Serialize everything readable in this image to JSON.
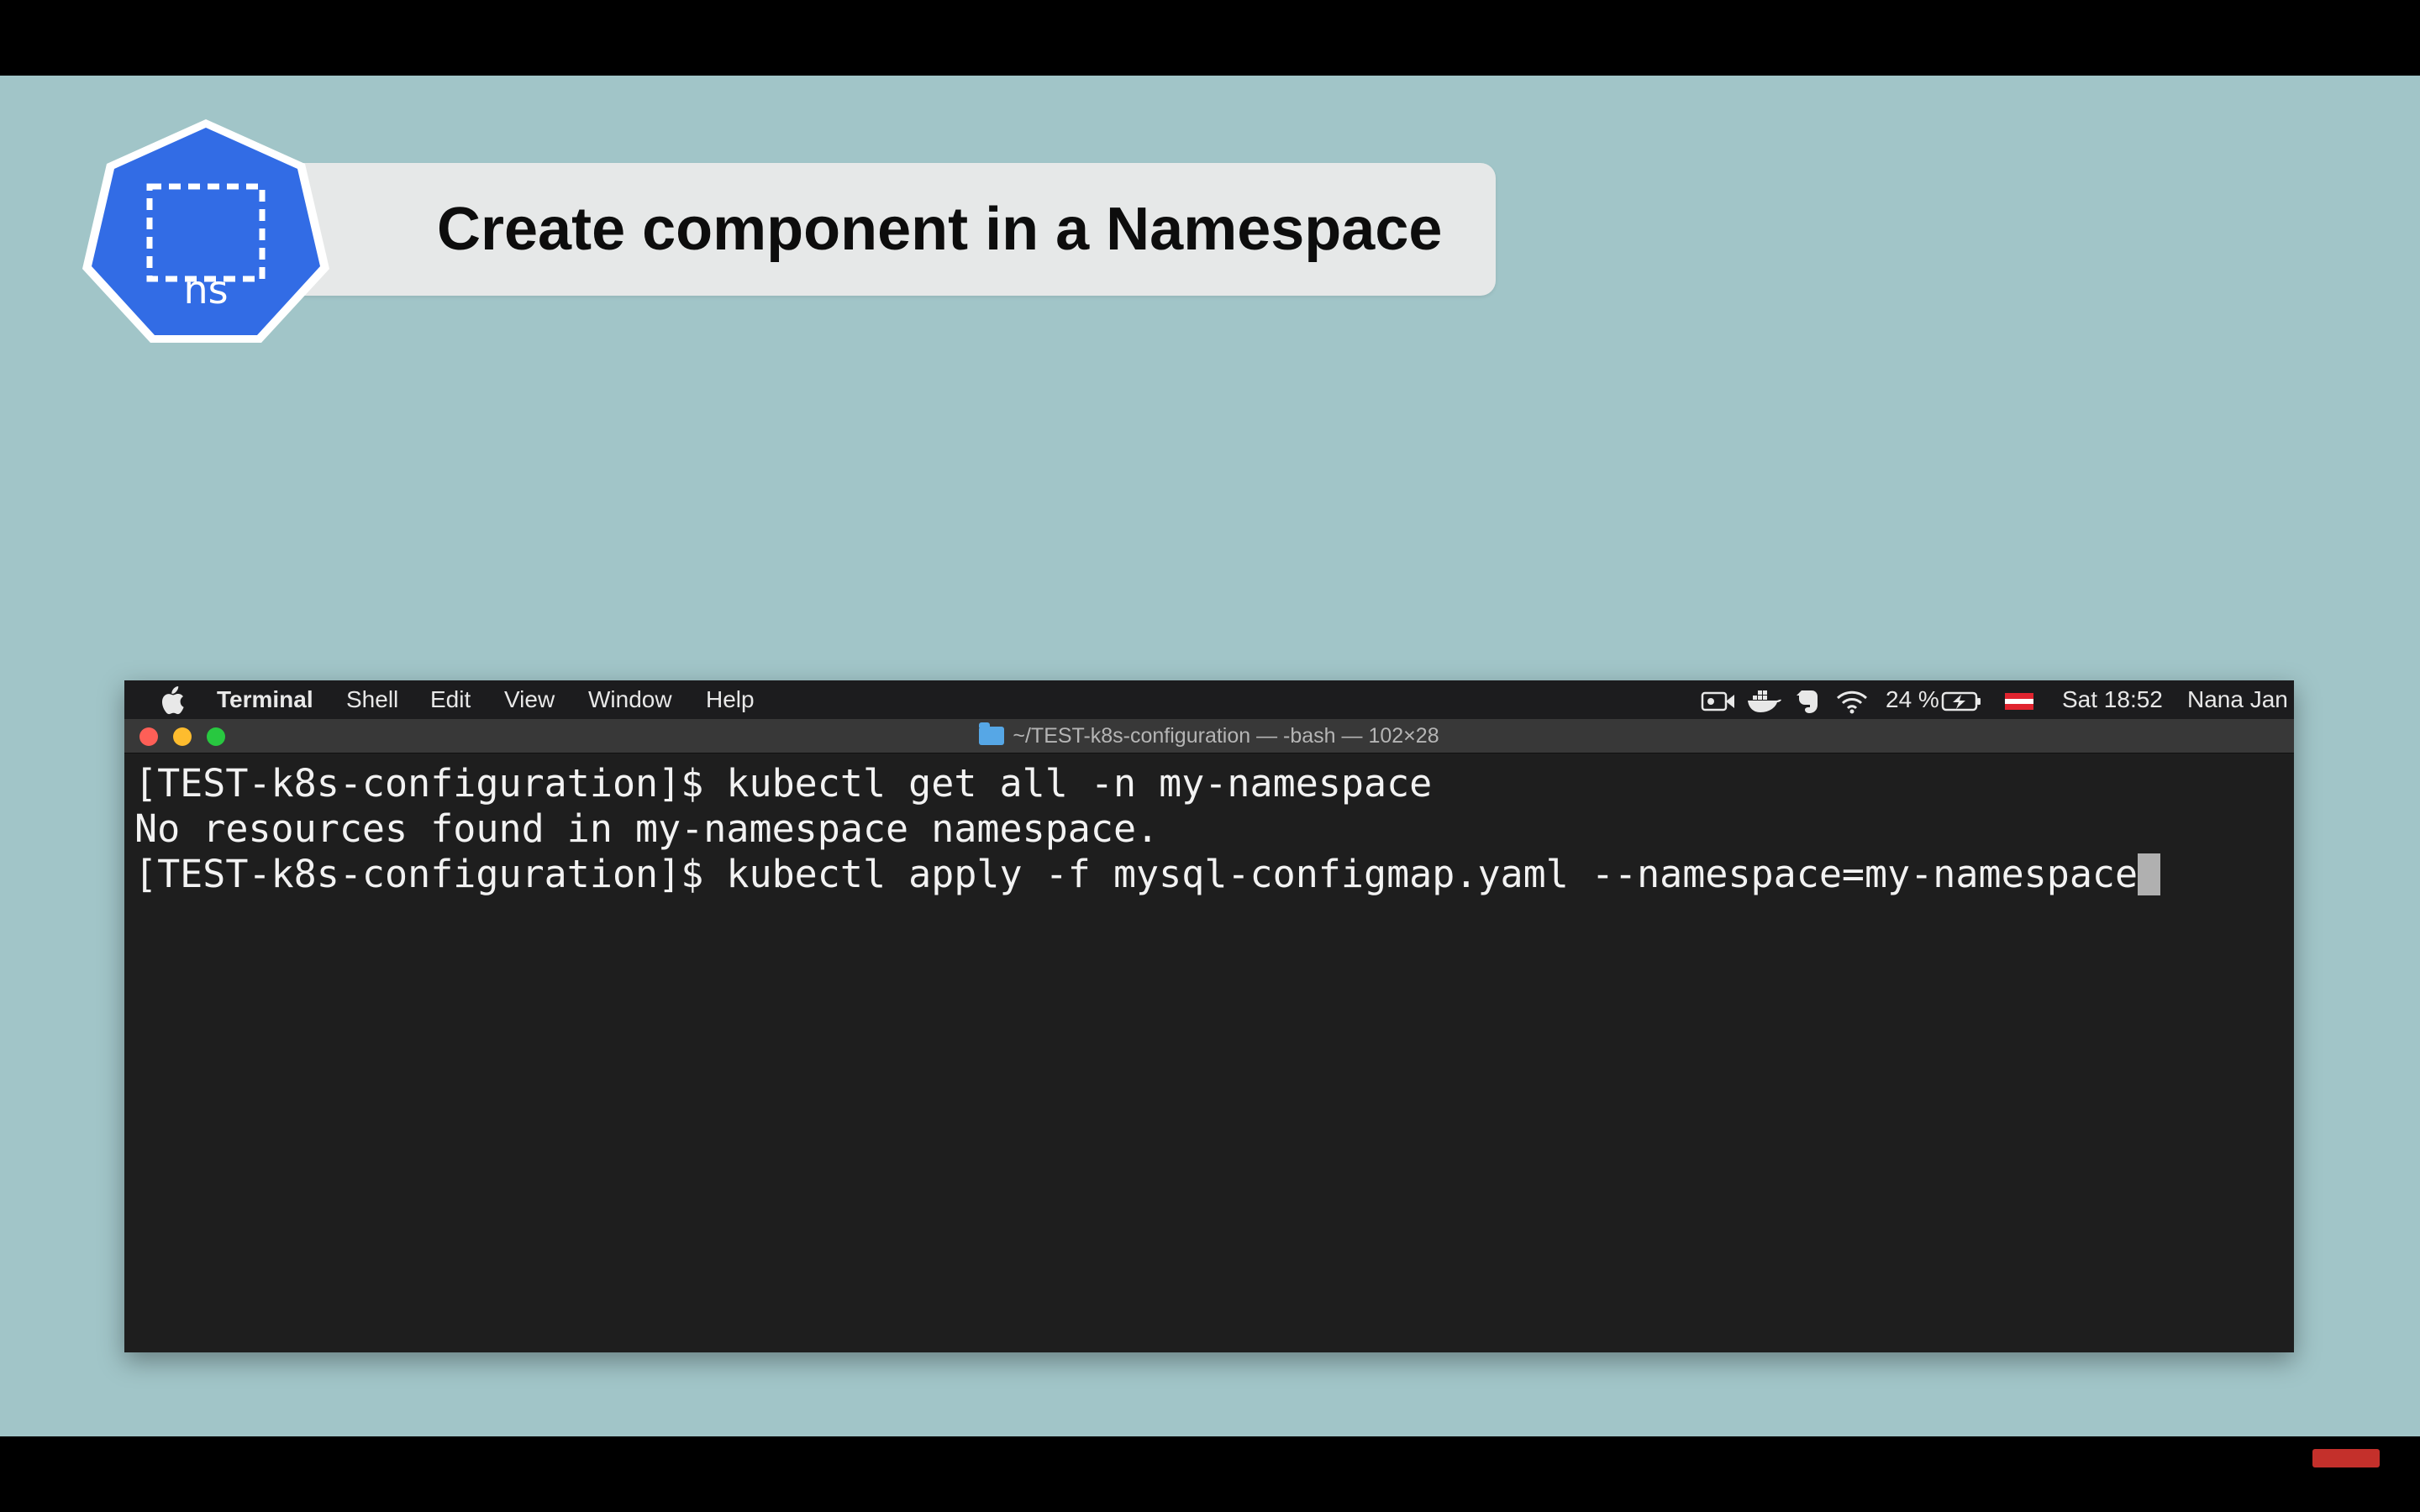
{
  "slide": {
    "title": "Create component in a Namespace",
    "badge_label": "ns"
  },
  "menubar": {
    "apple_icon": "",
    "app_name": "Terminal",
    "menus": [
      "Shell",
      "Edit",
      "View",
      "Window",
      "Help"
    ],
    "status_icons": [
      "video-camera-icon",
      "docker-whale-icon",
      "evernote-icon",
      "wifi-icon",
      "battery-icon",
      "flag-icon"
    ],
    "battery": "24 %",
    "clock": "Sat 18:52",
    "user": "Nana Jan"
  },
  "window": {
    "title": "~/TEST-k8s-configuration — -bash — 102×28"
  },
  "terminal": {
    "lines": [
      "[TEST-k8s-configuration]$ kubectl get all -n my-namespace",
      "No resources found in my-namespace namespace.",
      "[TEST-k8s-configuration]$ kubectl apply -f mysql-configmap.yaml --namespace=my-namespace"
    ]
  },
  "colors": {
    "slide_bg": "#a1c5c8",
    "badge_blue": "#326ce5",
    "terminal_bg": "#1e1e1e"
  }
}
